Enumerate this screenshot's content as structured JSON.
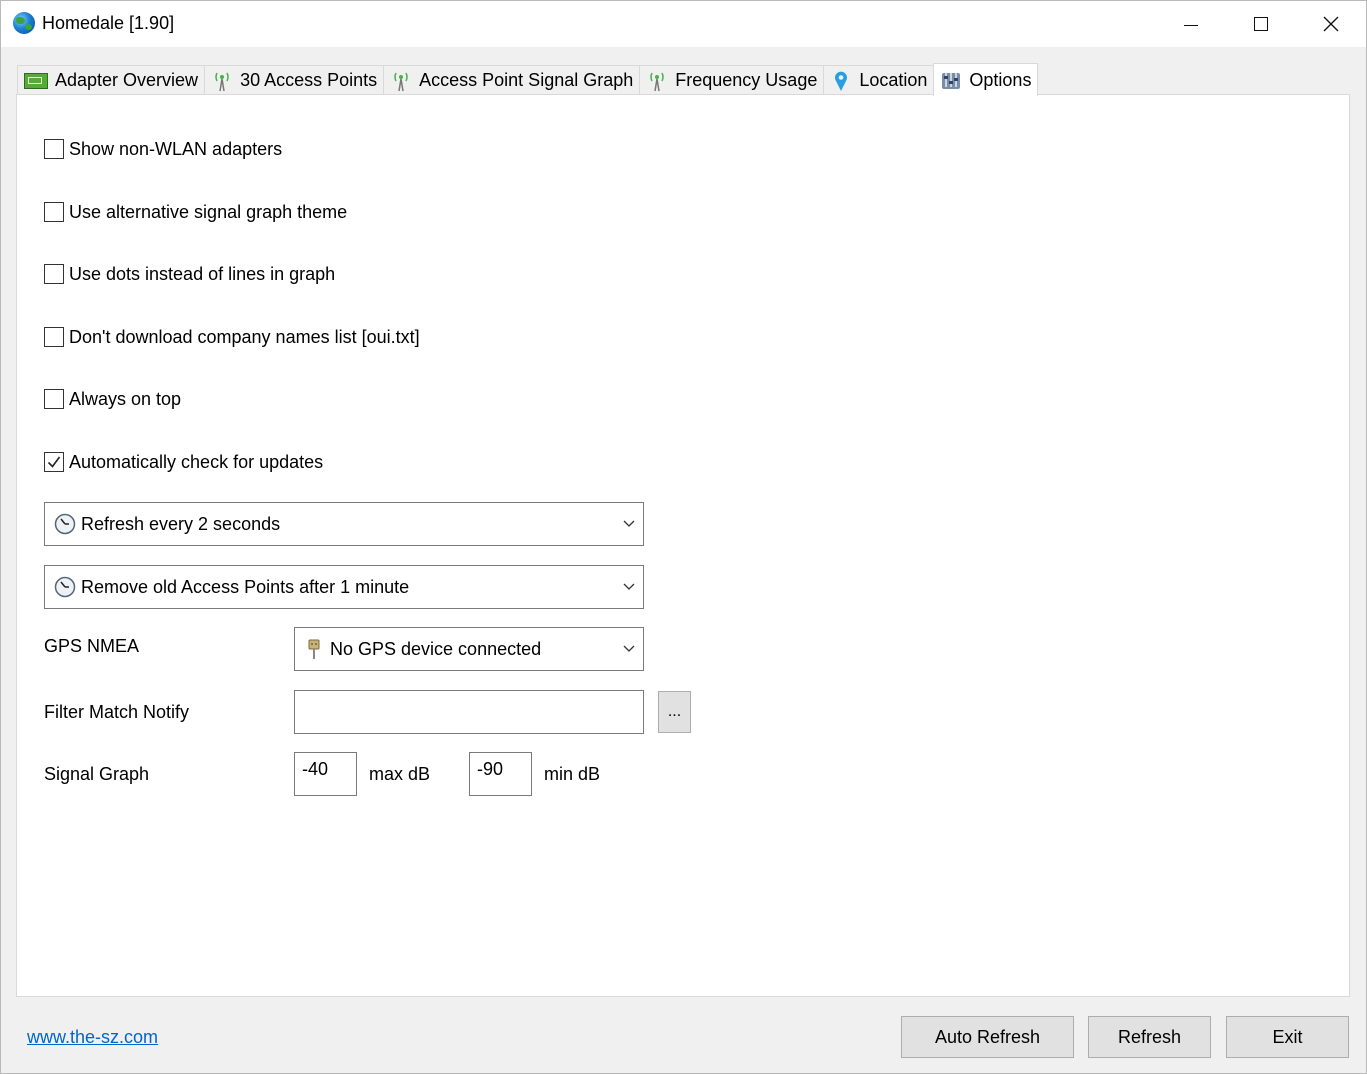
{
  "window": {
    "title": "Homedale [1.90]",
    "minimize": "minimize",
    "maximize": "maximize",
    "close": "close"
  },
  "tabs": [
    {
      "label": "Adapter Overview",
      "icon": "network-adapter-icon"
    },
    {
      "label": "30 Access Points",
      "icon": "antenna-icon"
    },
    {
      "label": "Access Point Signal Graph",
      "icon": "antenna-icon"
    },
    {
      "label": "Frequency Usage",
      "icon": "antenna-icon"
    },
    {
      "label": "Location",
      "icon": "location-pin-icon"
    },
    {
      "label": "Options",
      "icon": "options-icon",
      "active": true
    }
  ],
  "options": {
    "checkboxes": [
      {
        "label": "Show non-WLAN adapters",
        "checked": false
      },
      {
        "label": "Use alternative signal graph theme",
        "checked": false
      },
      {
        "label": "Use dots instead of lines in graph",
        "checked": false
      },
      {
        "label": "Don't download company names list [oui.txt]",
        "checked": false
      },
      {
        "label": "Always on top",
        "checked": false
      },
      {
        "label": "Automatically check for updates",
        "checked": true
      }
    ],
    "refresh_combo": "Refresh every 2 seconds",
    "remove_combo": "Remove old Access Points after 1 minute",
    "gps_label": "GPS NMEA",
    "gps_combo": "No GPS device connected",
    "filter_label": "Filter Match Notify",
    "filter_value": "",
    "filter_browse": "...",
    "signal_label": "Signal Graph",
    "max_value": "-40",
    "max_unit": "max dB",
    "min_value": "-90",
    "min_unit": "min dB"
  },
  "footer": {
    "link": "www.the-sz.com",
    "auto_refresh": "Auto Refresh",
    "refresh": "Refresh",
    "exit": "Exit"
  },
  "colors": {
    "link": "#0066cc",
    "button_bg": "#e1e1e1",
    "panel_bg": "#ffffff",
    "window_bg": "#f0f0f0"
  }
}
